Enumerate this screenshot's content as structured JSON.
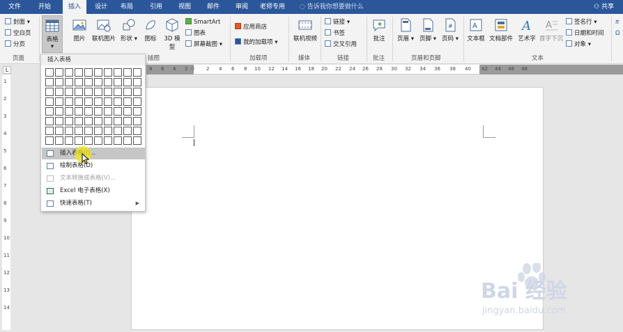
{
  "menubar": {
    "tabs": [
      "文件",
      "开始",
      "插入",
      "设计",
      "布局",
      "引用",
      "视图",
      "邮件",
      "审阅",
      "老师专用"
    ],
    "active_tab": "插入",
    "tell_me": "告诉我你想要做什么",
    "share": "共享"
  },
  "ribbon": {
    "pages_group": {
      "cover": "封面",
      "blank": "空白页",
      "break": "分页",
      "label": "页面"
    },
    "table_button": "表格",
    "illustrations": {
      "picture": "图片",
      "online_picture": "联机图片",
      "shapes": "形状",
      "icons": "图标",
      "model_3d": "3D 模型",
      "smartart": "SmartArt",
      "chart": "图表",
      "screenshot": "屏幕截图",
      "label": "插图"
    },
    "addins": {
      "store": "应用商店",
      "my_addins": "我的加载项",
      "label": "加载项"
    },
    "media": {
      "online_video": "联机视频",
      "label": "媒体"
    },
    "links": {
      "link": "链接",
      "bookmark": "书签",
      "cross_ref": "交叉引用",
      "label": "链接"
    },
    "comments": {
      "comment": "批注",
      "label": "批注"
    },
    "header_footer": {
      "header": "页眉",
      "footer": "页脚",
      "page_number": "页码",
      "label": "页眉和页脚"
    },
    "text": {
      "textbox": "文本框",
      "quick_parts": "文档部件",
      "wordart": "艺术字",
      "dropcap": "首字下沉",
      "signature": "签名行",
      "datetime": "日期和时间",
      "object": "对象",
      "label": "文本"
    }
  },
  "ruler": {
    "numbers": [
      "8",
      "6",
      "4",
      "2",
      "2",
      "4",
      "6",
      "8",
      "10",
      "12",
      "14",
      "16",
      "18",
      "20",
      "22",
      "24",
      "26",
      "28",
      "30",
      "32",
      "34",
      "36",
      "38",
      "40",
      "42",
      "44",
      "46",
      "48"
    ],
    "vnumbers": [
      "1",
      "2",
      "3",
      "4",
      "5",
      "6",
      "7",
      "8",
      "9",
      "10",
      "11",
      "12",
      "13",
      "14"
    ]
  },
  "dropdown": {
    "title": "插入表格",
    "grid_cols": 10,
    "grid_rows": 8,
    "items": [
      {
        "label": "插入表格(I)...",
        "highlighted": true,
        "disabled": false,
        "submenu": false
      },
      {
        "label": "绘制表格(D)",
        "highlighted": false,
        "disabled": false,
        "submenu": false
      },
      {
        "label": "文本转换成表格(V)...",
        "highlighted": false,
        "disabled": true,
        "submenu": false
      },
      {
        "label": "Excel 电子表格(X)",
        "highlighted": false,
        "disabled": false,
        "submenu": false
      },
      {
        "label": "快速表格(T)",
        "highlighted": false,
        "disabled": false,
        "submenu": true
      }
    ]
  },
  "watermark": {
    "text": "Bai 经验",
    "url": "jingyan.baidu.com"
  },
  "colors": {
    "brand": "#2b579a",
    "highlight": "#f0e61e"
  }
}
